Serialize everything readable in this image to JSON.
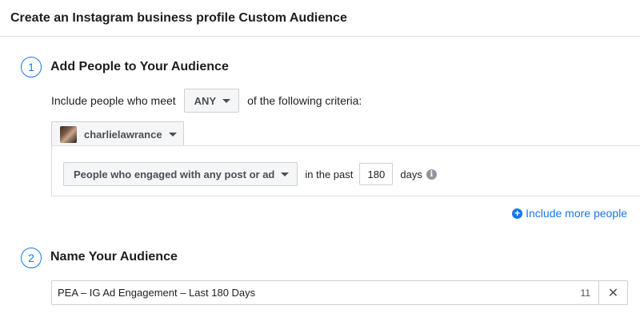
{
  "dialog": {
    "title": "Create an Instagram business profile Custom Audience"
  },
  "step1": {
    "number": "1",
    "title": "Add People to Your Audience",
    "criteria_prefix": "Include people who meet",
    "match_value": "ANY",
    "criteria_suffix": "of the following criteria:",
    "account_name": "charlielawrance",
    "rule": {
      "engagement_option": "People who engaged with any post or ad",
      "in_the_past": "in the past",
      "days_value": "180",
      "days_label": "days",
      "info_glyph": "i"
    },
    "include_more_label": "Include more people",
    "include_more_glyph": "+"
  },
  "step2": {
    "number": "2",
    "title": "Name Your Audience",
    "audience_name": "PEA – IG Ad Engagement – Last 180 Days",
    "char_count": "11",
    "clear_glyph": "✕"
  },
  "colors": {
    "accent": "#1877f2",
    "text": "#1c1e21",
    "border": "#ccd0d5"
  }
}
